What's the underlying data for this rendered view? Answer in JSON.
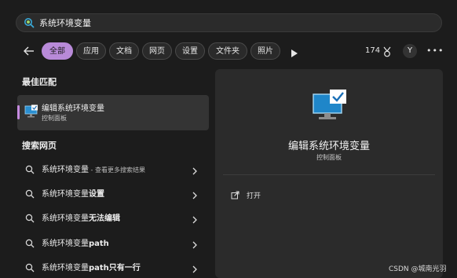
{
  "search": {
    "value": "系统环境变量"
  },
  "filters": {
    "chips": [
      "全部",
      "应用",
      "文档",
      "网页",
      "设置",
      "文件夹",
      "照片"
    ],
    "count": "174",
    "avatar": "Y"
  },
  "left": {
    "best_match_heading": "最佳匹配",
    "best_match": {
      "title": "编辑系统环境变量",
      "subtitle": "控制面板"
    },
    "web_heading": "搜索网页",
    "web_items": [
      {
        "prefix": "系统环境变量",
        "suffix": "",
        "sub": " - 查看更多搜索结果"
      },
      {
        "prefix": "系统环境变量",
        "suffix": "设置",
        "sub": ""
      },
      {
        "prefix": "系统环境变量",
        "suffix": "无法编辑",
        "sub": ""
      },
      {
        "prefix": "系统环境变量",
        "suffix": "path",
        "sub": ""
      },
      {
        "prefix": "系统环境变量",
        "suffix": "path只有一行",
        "sub": ""
      }
    ]
  },
  "detail": {
    "title": "编辑系统环境变量",
    "subtitle": "控制面板",
    "open_label": "打开"
  },
  "watermark": "CSDN @城南光羽",
  "colors": {
    "accent": "#b88ad8",
    "panel": "#2b2b2b",
    "background": "#1c1c1c"
  }
}
